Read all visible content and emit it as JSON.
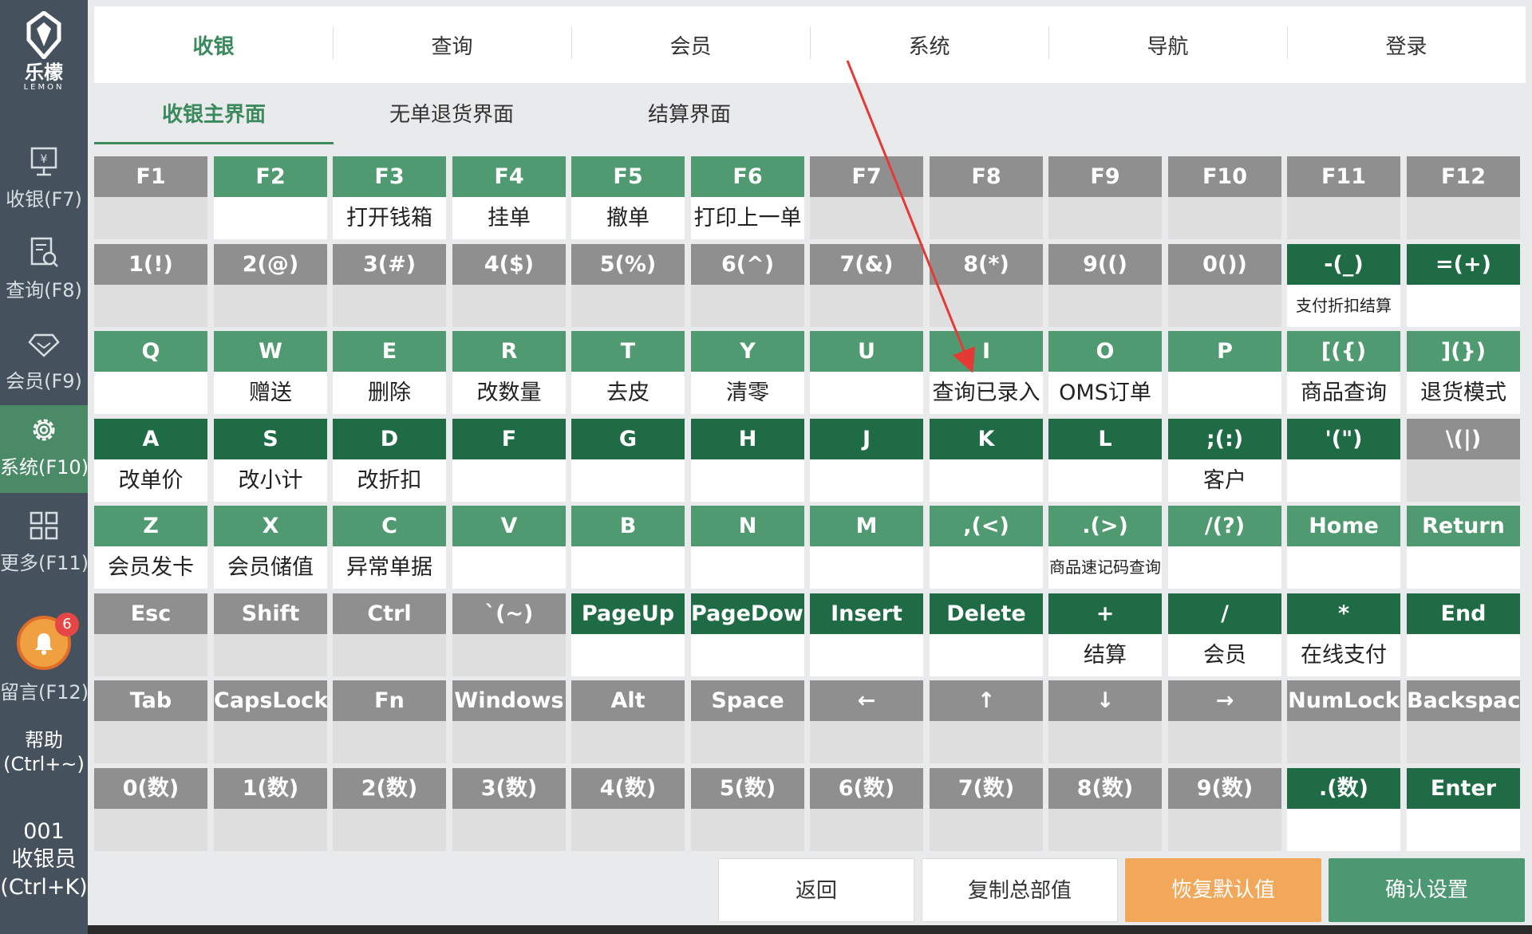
{
  "app": {
    "logo_text": "乐檬",
    "logo_sub": "LEMON"
  },
  "sidebar": {
    "items": [
      {
        "label": "收银(F7)",
        "icon": "cashier-icon"
      },
      {
        "label": "查询(F8)",
        "icon": "search-doc-icon"
      },
      {
        "label": "会员(F9)",
        "icon": "diamond-icon"
      },
      {
        "label": "系统(F10)",
        "icon": "gear-icon"
      },
      {
        "label": "更多(F11)",
        "icon": "grid-icon"
      }
    ],
    "message_label": "留言(F12)",
    "message_badge": "6",
    "help_line1": "帮助",
    "help_line2": "(Ctrl+~)",
    "user_id": "001",
    "user_role": "收银员",
    "user_shortcut": "(Ctrl+K)"
  },
  "topnav": {
    "items": [
      "收银",
      "查询",
      "会员",
      "系统",
      "导航",
      "登录"
    ]
  },
  "subtabs": {
    "items": [
      "收银主界面",
      "无单退货界面",
      "结算界面"
    ]
  },
  "colors": {
    "gray_top": "#8f8f8f",
    "green_light": "#4f9a70",
    "green_dark": "#1f6b45",
    "accent": "#3a8a5d",
    "orange": "#f2a85a"
  },
  "keys": [
    [
      {
        "key": "F1",
        "func": "",
        "t": "gray"
      },
      {
        "key": "F2",
        "func": "",
        "t": "light"
      },
      {
        "key": "F3",
        "func": "打开钱箱",
        "t": "light"
      },
      {
        "key": "F4",
        "func": "挂单",
        "t": "light"
      },
      {
        "key": "F5",
        "func": "撤单",
        "t": "light"
      },
      {
        "key": "F6",
        "func": "打印上一单",
        "t": "light"
      },
      {
        "key": "F7",
        "func": "",
        "t": "gray"
      },
      {
        "key": "F8",
        "func": "",
        "t": "gray"
      },
      {
        "key": "F9",
        "func": "",
        "t": "gray"
      },
      {
        "key": "F10",
        "func": "",
        "t": "gray"
      },
      {
        "key": "F11",
        "func": "",
        "t": "gray"
      },
      {
        "key": "F12",
        "func": "",
        "t": "gray"
      }
    ],
    [
      {
        "key": "1(!)",
        "func": "",
        "t": "gray"
      },
      {
        "key": "2(@)",
        "func": "",
        "t": "gray"
      },
      {
        "key": "3(#)",
        "func": "",
        "t": "gray"
      },
      {
        "key": "4($)",
        "func": "",
        "t": "gray"
      },
      {
        "key": "5(%)",
        "func": "",
        "t": "gray"
      },
      {
        "key": "6(^)",
        "func": "",
        "t": "gray"
      },
      {
        "key": "7(&)",
        "func": "",
        "t": "gray"
      },
      {
        "key": "8(*)",
        "func": "",
        "t": "gray"
      },
      {
        "key": "9(()",
        "func": "",
        "t": "gray"
      },
      {
        "key": "0())",
        "func": "",
        "t": "gray"
      },
      {
        "key": "-(_)",
        "func": "支付折扣结算",
        "t": "dark",
        "small": true
      },
      {
        "key": "=(+)",
        "func": "",
        "t": "dark"
      }
    ],
    [
      {
        "key": "Q",
        "func": "",
        "t": "light"
      },
      {
        "key": "W",
        "func": "赠送",
        "t": "light"
      },
      {
        "key": "E",
        "func": "删除",
        "t": "light"
      },
      {
        "key": "R",
        "func": "改数量",
        "t": "light"
      },
      {
        "key": "T",
        "func": "去皮",
        "t": "light"
      },
      {
        "key": "Y",
        "func": "清零",
        "t": "light"
      },
      {
        "key": "U",
        "func": "",
        "t": "light"
      },
      {
        "key": "I",
        "func": "查询已录入",
        "t": "light"
      },
      {
        "key": "O",
        "func": "OMS订单",
        "t": "light"
      },
      {
        "key": "P",
        "func": "",
        "t": "light"
      },
      {
        "key": "[({)",
        "func": "商品查询",
        "t": "light"
      },
      {
        "key": "](})",
        "func": "退货模式",
        "t": "light"
      }
    ],
    [
      {
        "key": "A",
        "func": "改单价",
        "t": "dark"
      },
      {
        "key": "S",
        "func": "改小计",
        "t": "dark"
      },
      {
        "key": "D",
        "func": "改折扣",
        "t": "dark"
      },
      {
        "key": "F",
        "func": "",
        "t": "dark"
      },
      {
        "key": "G",
        "func": "",
        "t": "dark"
      },
      {
        "key": "H",
        "func": "",
        "t": "dark"
      },
      {
        "key": "J",
        "func": "",
        "t": "dark"
      },
      {
        "key": "K",
        "func": "",
        "t": "dark"
      },
      {
        "key": "L",
        "func": "",
        "t": "dark"
      },
      {
        "key": ";(:)",
        "func": "客户",
        "t": "dark"
      },
      {
        "key": "'(\")",
        "func": "",
        "t": "dark"
      },
      {
        "key": "\\(|)",
        "func": "",
        "t": "gray"
      }
    ],
    [
      {
        "key": "Z",
        "func": "会员发卡",
        "t": "light"
      },
      {
        "key": "X",
        "func": "会员储值",
        "t": "light"
      },
      {
        "key": "C",
        "func": "异常单据",
        "t": "light"
      },
      {
        "key": "V",
        "func": "",
        "t": "light"
      },
      {
        "key": "B",
        "func": "",
        "t": "light"
      },
      {
        "key": "N",
        "func": "",
        "t": "light"
      },
      {
        "key": "M",
        "func": "",
        "t": "light"
      },
      {
        "key": ",(<)",
        "func": "",
        "t": "light"
      },
      {
        "key": ".(>)",
        "func": "商品速记码查询",
        "t": "light",
        "small": true
      },
      {
        "key": "/(?)",
        "func": "",
        "t": "light"
      },
      {
        "key": "Home",
        "func": "",
        "t": "light"
      },
      {
        "key": "Return",
        "func": "",
        "t": "light"
      }
    ],
    [
      {
        "key": "Esc",
        "func": "",
        "t": "gray"
      },
      {
        "key": "Shift",
        "func": "",
        "t": "gray"
      },
      {
        "key": "Ctrl",
        "func": "",
        "t": "gray"
      },
      {
        "key": "`(~)",
        "func": "",
        "t": "gray"
      },
      {
        "key": "PageUp",
        "func": "",
        "t": "dark"
      },
      {
        "key": "PageDown",
        "func": "",
        "t": "dark"
      },
      {
        "key": "Insert",
        "func": "",
        "t": "dark"
      },
      {
        "key": "Delete",
        "func": "",
        "t": "dark"
      },
      {
        "key": "+",
        "func": "结算",
        "t": "dark"
      },
      {
        "key": "/",
        "func": "会员",
        "t": "dark"
      },
      {
        "key": "*",
        "func": "在线支付",
        "t": "dark"
      },
      {
        "key": "End",
        "func": "",
        "t": "dark"
      }
    ],
    [
      {
        "key": "Tab",
        "func": "",
        "t": "gray"
      },
      {
        "key": "CapsLock",
        "func": "",
        "t": "gray"
      },
      {
        "key": "Fn",
        "func": "",
        "t": "gray"
      },
      {
        "key": "Windows",
        "func": "",
        "t": "gray"
      },
      {
        "key": "Alt",
        "func": "",
        "t": "gray"
      },
      {
        "key": "Space",
        "func": "",
        "t": "gray"
      },
      {
        "key": "←",
        "func": "",
        "t": "gray"
      },
      {
        "key": "↑",
        "func": "",
        "t": "gray"
      },
      {
        "key": "↓",
        "func": "",
        "t": "gray"
      },
      {
        "key": "→",
        "func": "",
        "t": "gray"
      },
      {
        "key": "NumLock",
        "func": "",
        "t": "gray"
      },
      {
        "key": "Backspace",
        "func": "",
        "t": "gray"
      }
    ],
    [
      {
        "key": "0(数)",
        "func": "",
        "t": "gray"
      },
      {
        "key": "1(数)",
        "func": "",
        "t": "gray"
      },
      {
        "key": "2(数)",
        "func": "",
        "t": "gray"
      },
      {
        "key": "3(数)",
        "func": "",
        "t": "gray"
      },
      {
        "key": "4(数)",
        "func": "",
        "t": "gray"
      },
      {
        "key": "5(数)",
        "func": "",
        "t": "gray"
      },
      {
        "key": "6(数)",
        "func": "",
        "t": "gray"
      },
      {
        "key": "7(数)",
        "func": "",
        "t": "gray"
      },
      {
        "key": "8(数)",
        "func": "",
        "t": "gray"
      },
      {
        "key": "9(数)",
        "func": "",
        "t": "gray"
      },
      {
        "key": ".(数)",
        "func": "",
        "t": "dark"
      },
      {
        "key": "Enter",
        "func": "",
        "t": "dark"
      }
    ]
  ],
  "buttons": {
    "back": "返回",
    "copy_hq": "复制总部值",
    "restore_default": "恢复默认值",
    "confirm": "确认设置"
  }
}
